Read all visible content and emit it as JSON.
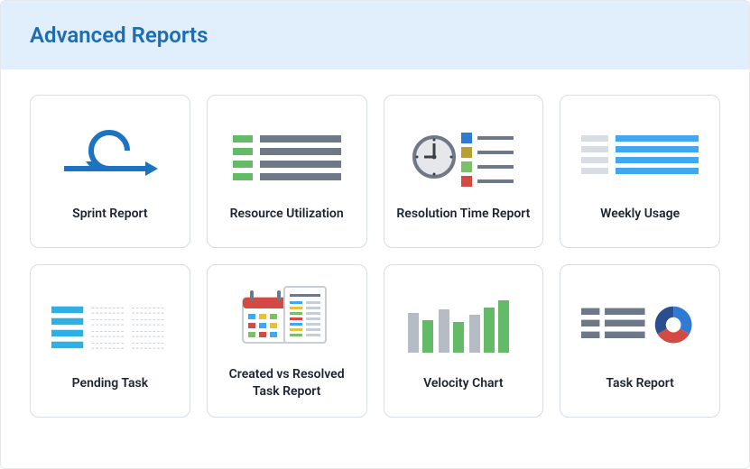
{
  "header": {
    "title": "Advanced Reports"
  },
  "cards": [
    {
      "name": "sprint-report",
      "icon": "sprint-icon",
      "label": "Sprint Report"
    },
    {
      "name": "resource-utilization",
      "icon": "resource-icon",
      "label": "Resource Utilization"
    },
    {
      "name": "resolution-time",
      "icon": "resolution-icon",
      "label": "Resolution Time Report"
    },
    {
      "name": "weekly-usage",
      "icon": "weekly-usage-icon",
      "label": "Weekly Usage"
    },
    {
      "name": "pending-task",
      "icon": "pending-task-icon",
      "label": "Pending Task"
    },
    {
      "name": "created-vs-resolved",
      "icon": "created-resolved-icon",
      "label": "Created vs Resolved Task Report"
    },
    {
      "name": "velocity-chart",
      "icon": "velocity-icon",
      "label": "Velocity Chart"
    },
    {
      "name": "task-report",
      "icon": "task-report-icon",
      "label": "Task Report"
    }
  ],
  "colors": {
    "blue": "#1c74c1",
    "gray": "#6e7886",
    "green": "#63bb67",
    "lightgray": "#d8dde3",
    "cyan": "#2fb0e4",
    "darkblue": "#2a4f8f",
    "red": "#d24a43",
    "yellow": "#e6c13e",
    "mustard": "#b7a02f",
    "greenblock": "#7bbf6a"
  }
}
